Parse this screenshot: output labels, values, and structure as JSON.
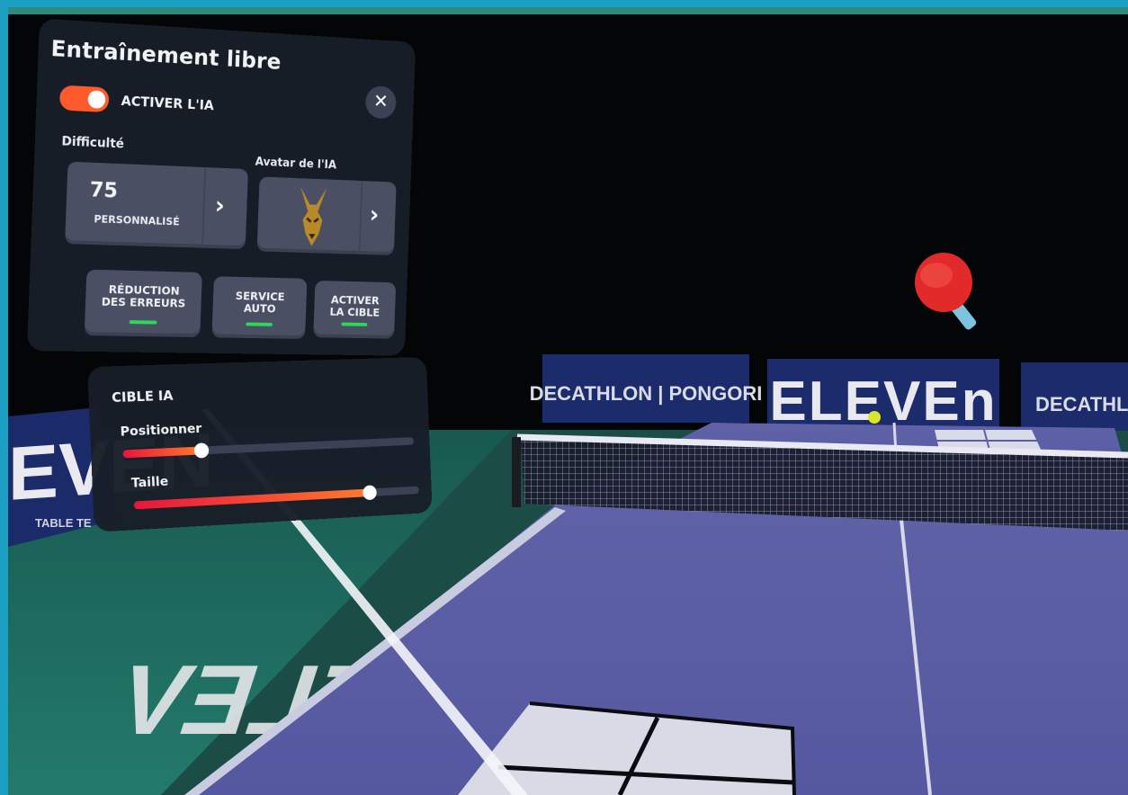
{
  "panel": {
    "title": "Entraînement libre",
    "close_symbol": "✕",
    "ai_toggle": {
      "label": "ACTIVER L'IA",
      "on": true
    },
    "difficulty": {
      "label": "Difficulté",
      "value": "75",
      "mode": "PERSONNALISÉ"
    },
    "avatar": {
      "label": "Avatar de l'IA",
      "icon": "fox-mask-icon"
    },
    "next_symbol": "›",
    "options": [
      {
        "line1": "RÉDUCTION",
        "line2": "DES ERREURS",
        "active": true
      },
      {
        "line1": "SERVICE",
        "line2": "AUTO",
        "active": true
      },
      {
        "line1": "ACTIVER",
        "line2": "LA CIBLE",
        "active": true
      }
    ]
  },
  "target_panel": {
    "title": "CIBLE IA",
    "sliders": [
      {
        "label": "Positionner",
        "value": 0.26
      },
      {
        "label": "Taille",
        "value": 0.82
      }
    ]
  },
  "scene": {
    "banners": [
      "DECATHLON | PONGORI",
      "ELEVEn",
      "DECATHLO"
    ],
    "left_banner": "EVEN",
    "left_banner_sub": "TABLE TE",
    "floor_logo": "ELEV",
    "colors": {
      "table": "#5a5ca6",
      "floor": "#1f6e63",
      "banner": "#1c2c6a",
      "toggle": "#ff5a2b",
      "indicator": "#2ed659",
      "paddle": "#e32a2a",
      "ball": "#d8e629"
    }
  }
}
